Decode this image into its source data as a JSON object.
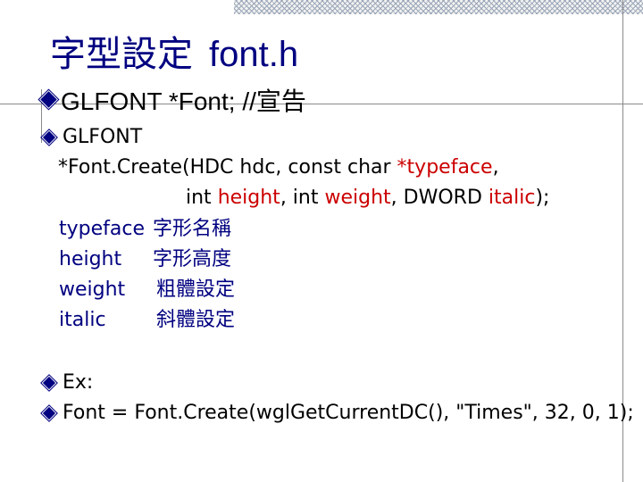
{
  "slide": {
    "title_cjk": "字型設定",
    "title_en": "font.h",
    "bullet1": "GLFONT *Font; //宣告",
    "code": {
      "line1": "GLFONT",
      "line2_a": "*Font.Create(HDC hdc, const char ",
      "line2_b": "*typeface",
      "line2_c": ",",
      "line3_a": "int ",
      "line3_b": "height",
      "line3_c": ", int ",
      "line3_d": "weight",
      "line3_e": ", DWORD ",
      "line3_f": "italic",
      "line3_g": ");"
    },
    "params": [
      {
        "name": "typeface",
        "desc": "字形名稱"
      },
      {
        "name": "height",
        "desc": "字形高度"
      },
      {
        "name": "weight",
        "desc": "粗體設定"
      },
      {
        "name": "italic",
        "desc": "斜體設定"
      }
    ],
    "ex_label": "Ex:",
    "ex_code": "Font = Font.Create(wglGetCurrentDC(), \"Times\", 32, 0, 1);"
  },
  "colors": {
    "title": "#000080",
    "highlight": "#cc0000",
    "bullet": "#000080"
  }
}
